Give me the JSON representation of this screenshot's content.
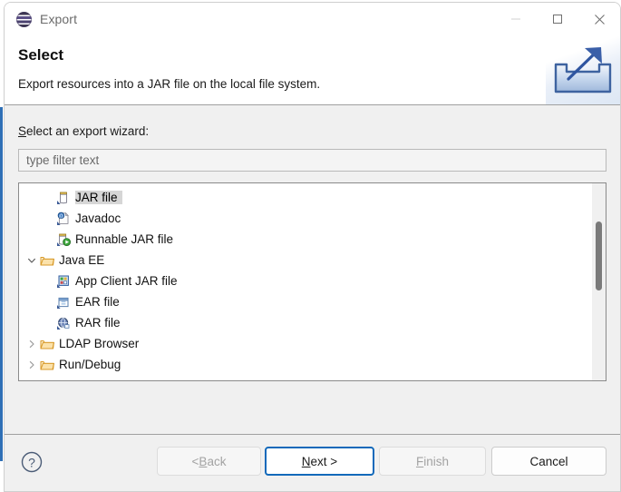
{
  "window": {
    "title": "Export",
    "logo_icon": "eclipse-logo-icon",
    "controls": {
      "minimize": "minimize-icon",
      "maximize": "maximize-icon",
      "close": "close-icon"
    }
  },
  "header": {
    "title": "Select",
    "description": "Export resources into a JAR file on the local file system.",
    "banner_icon": "export-tray-arrow-icon"
  },
  "form": {
    "label_prefix": "S",
    "label_rest": "elect an export wizard:",
    "filter_placeholder": "type filter text",
    "filter_value": ""
  },
  "tree": {
    "items": [
      {
        "label": "JAR file",
        "icon": "jar-file-icon",
        "indent": 2,
        "twisty": "",
        "selected": true
      },
      {
        "label": "Javadoc",
        "icon": "javadoc-icon",
        "indent": 2,
        "twisty": "",
        "selected": false
      },
      {
        "label": "Runnable JAR file",
        "icon": "runnable-jar-icon",
        "indent": 2,
        "twisty": "",
        "selected": false
      },
      {
        "label": "Java EE",
        "icon": "folder-open-icon",
        "indent": 1,
        "twisty": "expanded",
        "selected": false
      },
      {
        "label": "App Client JAR file",
        "icon": "app-client-jar-icon",
        "indent": 2,
        "twisty": "",
        "selected": false
      },
      {
        "label": "EAR file",
        "icon": "ear-file-icon",
        "indent": 2,
        "twisty": "",
        "selected": false
      },
      {
        "label": "RAR file",
        "icon": "rar-file-icon",
        "indent": 2,
        "twisty": "",
        "selected": false
      },
      {
        "label": "LDAP Browser",
        "icon": "folder-open-icon",
        "indent": 1,
        "twisty": "collapsed",
        "selected": false
      },
      {
        "label": "Run/Debug",
        "icon": "folder-open-icon",
        "indent": 1,
        "twisty": "collapsed",
        "selected": false
      }
    ],
    "scrollbar": {
      "visible": true
    }
  },
  "footer": {
    "help_icon": "help-question-icon",
    "buttons": [
      {
        "name": "back",
        "text_before": "< ",
        "mnemonic": "B",
        "text_after": "ack",
        "disabled": true,
        "default": false
      },
      {
        "name": "next",
        "text_before": "",
        "mnemonic": "N",
        "text_after": "ext >",
        "disabled": false,
        "default": true
      },
      {
        "name": "finish",
        "text_before": "",
        "mnemonic": "F",
        "text_after": "inish",
        "disabled": true,
        "default": false
      },
      {
        "name": "cancel",
        "text_before": "",
        "mnemonic": "",
        "text_after": "Cancel",
        "disabled": false,
        "default": false
      }
    ]
  },
  "colors": {
    "accent": "#1169ba",
    "body_bg": "#f0f0f0",
    "selection": "#d6d6d6",
    "folder": "#e9a93b"
  }
}
